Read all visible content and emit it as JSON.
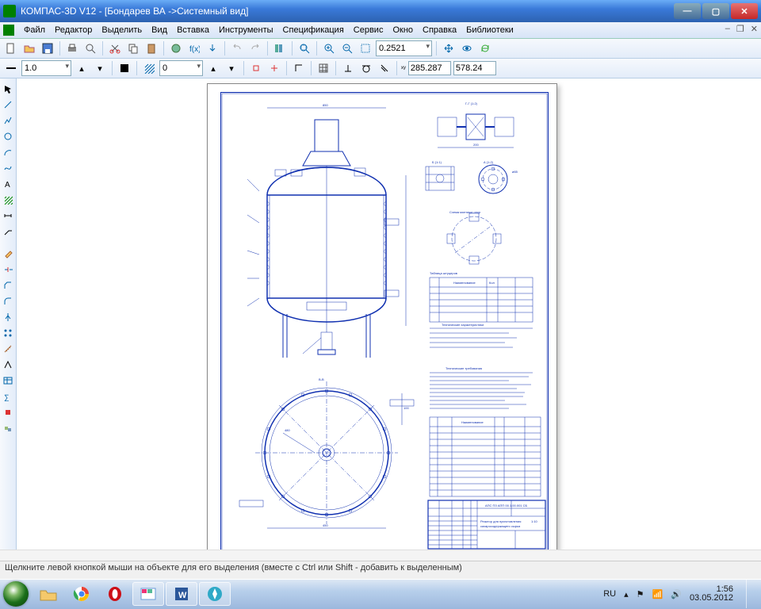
{
  "window": {
    "title": "КОМПАС-3D V12 - [Бондарев ВА ->Системный вид]"
  },
  "menu": {
    "file": "Файл",
    "edit": "Редактор",
    "select": "Выделить",
    "view": "Вид",
    "insert": "Вставка",
    "tools": "Инструменты",
    "spec": "Спецификация",
    "service": "Сервис",
    "window": "Окно",
    "help": "Справка",
    "libs": "Библиотеки"
  },
  "toolbar2": {
    "line_weight": "1.0",
    "offset": "0",
    "zoom_value": "0.2521",
    "coord_x": "285.287",
    "coord_y": "578.24"
  },
  "status": {
    "hint": "Щелкните левой кнопкой мыши на объекте для его выделения (вместе с Ctrl или Shift - добавить к выделенным)"
  },
  "taskbar": {
    "lang": "RU",
    "time": "1:56",
    "date": "03.05.2012"
  },
  "drawing": {
    "view_label_top": "Г-Г (1:2)",
    "view_label_b": "Б (1:1)",
    "view_label_a": "А (1:2)",
    "view_label_bb": "В-В",
    "dim_top": "850",
    "dim_radius": "450",
    "dim_bottom": "450",
    "dim_span": "480",
    "dim_height": "100",
    "table1_title": "Таблица штуцеров",
    "tech_req_title": "Технические требования",
    "tech_char_title": "Технические характеристики",
    "tbl_col_name": "Наименование",
    "tbl_col_qty": "Кол",
    "titleblk_code": "АПС ПЗ АПП 00.1.00.001 СБ",
    "titleblk_name": "Реактор для приготовления",
    "titleblk_sub": "сахаросодержащего сырья",
    "titleblk_scale": "1:10",
    "scheme_label": "Схема монтажа опор"
  }
}
